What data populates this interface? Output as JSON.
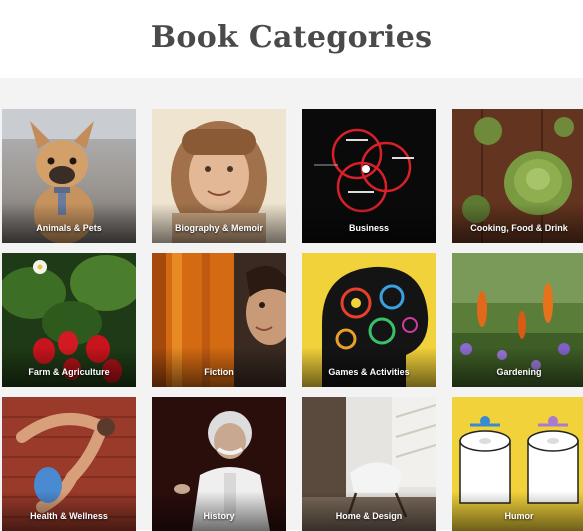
{
  "header": {
    "title": "Book Categories"
  },
  "categories": [
    {
      "label": "Animals & Pets",
      "icon": "dog-photo"
    },
    {
      "label": "Biography & Memoir",
      "icon": "vintage-portrait-photo"
    },
    {
      "label": "Business",
      "icon": "venn-diagram-photo"
    },
    {
      "label": "Cooking, Food & Drink",
      "icon": "artichoke-photo"
    },
    {
      "label": "Farm & Agriculture",
      "icon": "strawberries-photo"
    },
    {
      "label": "Fiction",
      "icon": "painted-portrait-photo"
    },
    {
      "label": "Games & Activities",
      "icon": "brain-gears-photo"
    },
    {
      "label": "Gardening",
      "icon": "flowers-photo"
    },
    {
      "label": "Health & Wellness",
      "icon": "yoga-pose-photo"
    },
    {
      "label": "History",
      "icon": "historical-portrait-photo"
    },
    {
      "label": "Home & Design",
      "icon": "interior-chair-photo"
    },
    {
      "label": "Humor",
      "icon": "toilet-paper-photo"
    }
  ]
}
